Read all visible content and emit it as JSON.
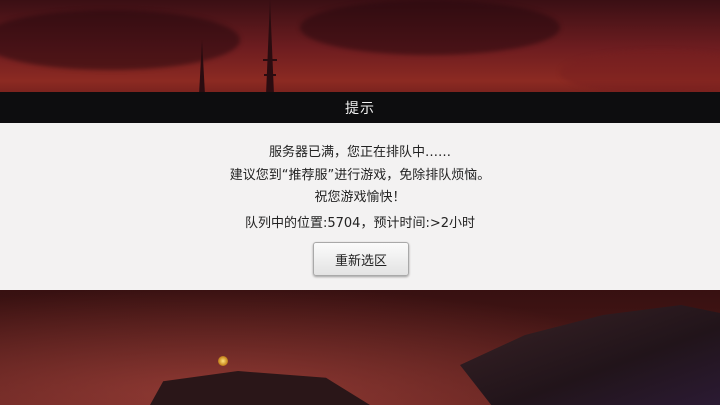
{
  "dialog": {
    "title": "提示",
    "lines": [
      "服务器已满，您正在排队中……",
      "建议您到“推荐服”进行游戏，免除排队烦恼。",
      "祝您游戏愉快！"
    ],
    "queue_info": "队列中的位置:5704，预计时间:>2小时",
    "reselect_button": "重新选区"
  },
  "colors": {
    "band": "#0d0d0f",
    "panel": "#f3f2f2",
    "sky_red": "#8c2a22"
  }
}
